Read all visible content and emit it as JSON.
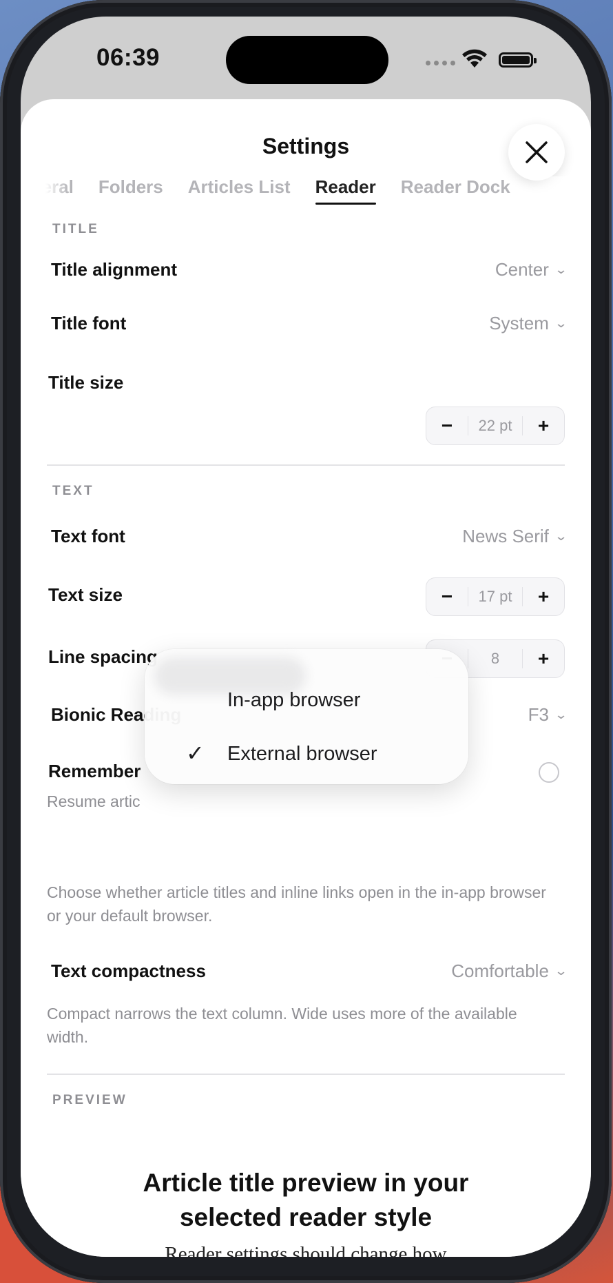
{
  "status_bar": {
    "time": "06:39"
  },
  "sheet": {
    "title": "Settings"
  },
  "tabs": [
    {
      "label": "General",
      "active": false
    },
    {
      "label": "Folders",
      "active": false
    },
    {
      "label": "Articles List",
      "active": false
    },
    {
      "label": "Reader",
      "active": true
    },
    {
      "label": "Reader Dock",
      "active": false
    }
  ],
  "title_section": {
    "label": "TITLE",
    "alignment": {
      "label": "Title alignment",
      "value": "Center"
    },
    "font": {
      "label": "Title font",
      "value": "System"
    },
    "size": {
      "label": "Title size",
      "value": "22 pt",
      "minus": "−",
      "plus": "+"
    }
  },
  "text_section": {
    "label": "TEXT",
    "font": {
      "label": "Text font",
      "value": "News Serif"
    },
    "size": {
      "label": "Text size",
      "value": "17 pt",
      "minus": "−",
      "plus": "+"
    },
    "line_spacing": {
      "label": "Line spacing",
      "value": "8",
      "minus": "−",
      "plus": "+"
    },
    "bionic": {
      "label": "Bionic Reading",
      "value": "F3"
    },
    "remember": {
      "label": "Remember",
      "desc": "Resume artic"
    },
    "browser_desc": "Choose whether article titles and inline links open in the in-app browser or your default browser.",
    "compactness": {
      "label": "Text compactness",
      "value": "Comfortable"
    },
    "compactness_desc": "Compact narrows the text column. Wide uses more of the available width."
  },
  "browser_menu": {
    "items": [
      {
        "label": "In-app browser",
        "checked": false
      },
      {
        "label": "External browser",
        "checked": true
      }
    ],
    "check_glyph": "✓"
  },
  "preview_section": {
    "label": "PREVIEW",
    "title_line1": "Article title preview in your",
    "title_line2": "selected reader style",
    "body": "Reader settings should change how"
  }
}
